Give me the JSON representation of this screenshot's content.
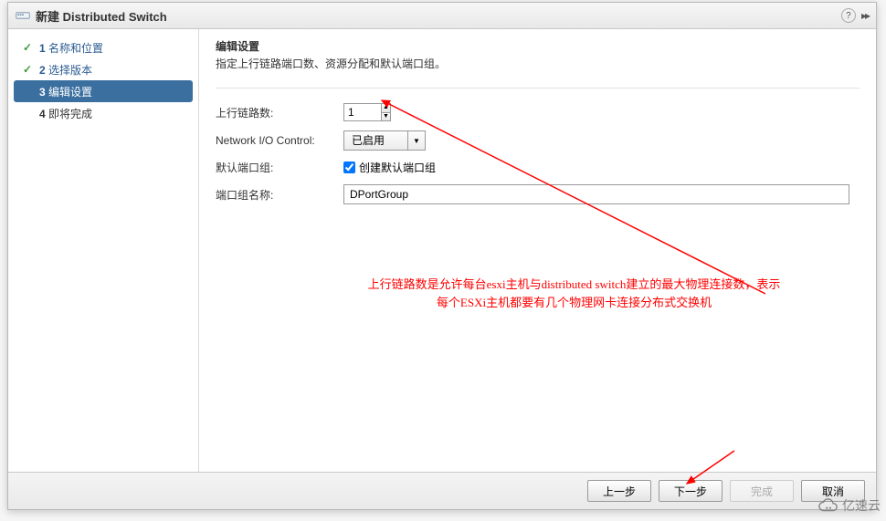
{
  "window": {
    "title": "新建 Distributed Switch",
    "help_glyph": "?",
    "expand_glyph": "▸▸"
  },
  "steps": [
    {
      "num": "1",
      "label": "名称和位置",
      "state": "done"
    },
    {
      "num": "2",
      "label": "选择版本",
      "state": "done"
    },
    {
      "num": "3",
      "label": "编辑设置",
      "state": "current"
    },
    {
      "num": "4",
      "label": "即将完成",
      "state": "pending"
    }
  ],
  "section": {
    "title": "编辑设置",
    "desc": "指定上行链路端口数、资源分配和默认端口组。"
  },
  "form": {
    "uplinks_label": "上行链路数:",
    "uplinks_value": "1",
    "nioc_label": "Network I/O Control:",
    "nioc_value": "已启用",
    "default_pg_label": "默认端口组:",
    "default_pg_checkbox_label": "创建默认端口组",
    "default_pg_checked": true,
    "pg_name_label": "端口组名称:",
    "pg_name_value": "DPortGroup"
  },
  "annotation": {
    "line1": "上行链路数是允许每台esxi主机与distributed  switch建立的最大物理连接数，表示",
    "line2": "每个ESXi主机都要有几个物理网卡连接分布式交换机"
  },
  "footer": {
    "back": "上一步",
    "next": "下一步",
    "finish": "完成",
    "cancel": "取消"
  },
  "watermark": "亿速云"
}
